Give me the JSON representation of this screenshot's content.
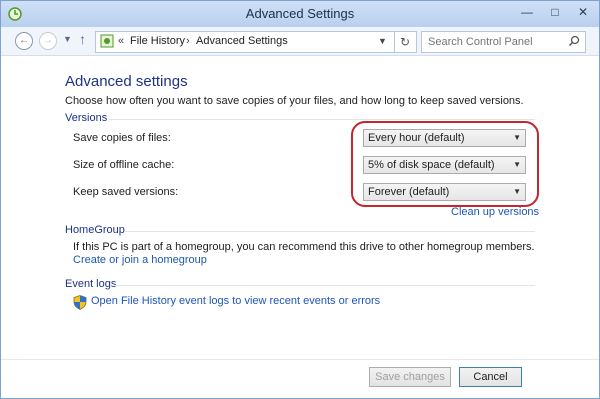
{
  "window": {
    "title": "Advanced Settings"
  },
  "nav": {
    "breadcrumb": [
      "File History",
      "Advanced Settings"
    ],
    "separator": "«",
    "separator2": "›",
    "search_placeholder": "Search Control Panel"
  },
  "page": {
    "heading": "Advanced settings",
    "description": "Choose how often you want to save copies of your files, and how long to keep saved versions."
  },
  "versions": {
    "title": "Versions",
    "rows": [
      {
        "label": "Save copies of files:",
        "value": "Every hour (default)"
      },
      {
        "label": "Size of offline cache:",
        "value": "5% of disk space (default)"
      },
      {
        "label": "Keep saved versions:",
        "value": "Forever (default)"
      }
    ],
    "cleanup_link": "Clean up versions"
  },
  "homegroup": {
    "title": "HomeGroup",
    "text": "If this PC is part of a homegroup, you can recommend this drive to other homegroup members.",
    "link": "Create or join a homegroup"
  },
  "eventlogs": {
    "title": "Event logs",
    "link": "Open File History event logs to view recent events or errors"
  },
  "buttons": {
    "save": "Save changes",
    "cancel": "Cancel"
  },
  "colors": {
    "heading": "#1e3287",
    "link": "#1e56b5",
    "highlight": "#c1272d"
  }
}
